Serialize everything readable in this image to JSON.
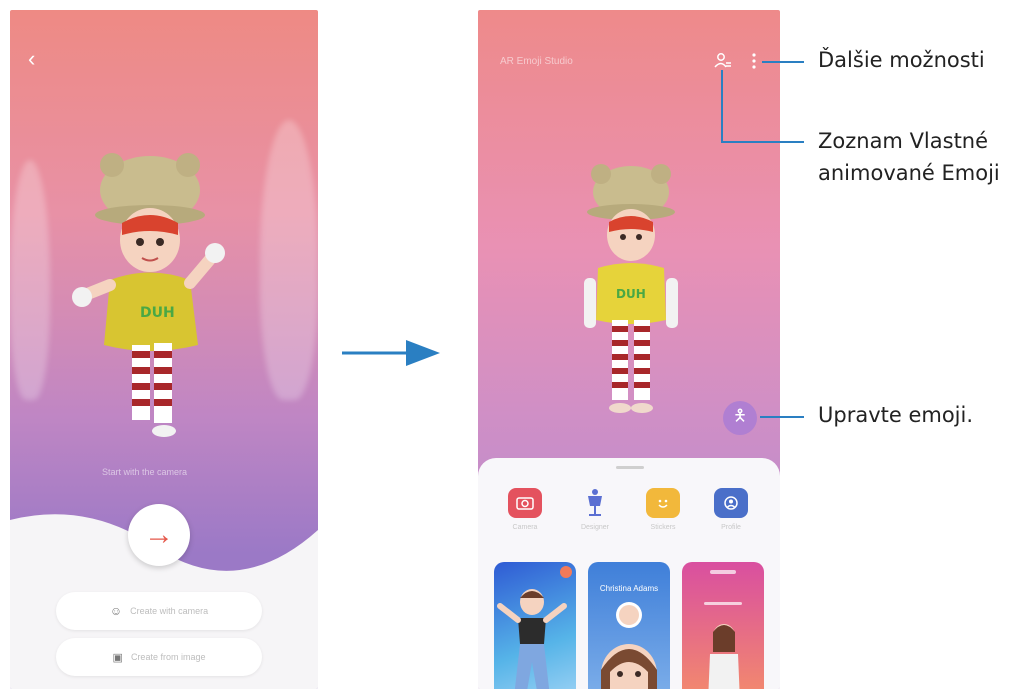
{
  "left_phone": {
    "back_glyph": "‹",
    "next_arrow_glyph": "→",
    "faded_prompt": "Start with the camera",
    "buttons": [
      {
        "label": "Create with camera",
        "icon": "smiley-icon"
      },
      {
        "label": "Create from image",
        "icon": "image-icon"
      }
    ]
  },
  "right_phone": {
    "faded_title": "AR Emoji Studio",
    "tools": [
      {
        "label": "Camera",
        "icon": "camera-icon",
        "color": "#e4525e"
      },
      {
        "label": "Designer",
        "icon": "mannequin-icon",
        "color": "#5b6fd2"
      },
      {
        "label": "Stickers",
        "icon": "sticker-icon",
        "color": "#f2b83b"
      },
      {
        "label": "Profile",
        "icon": "profile-icon",
        "color": "#4a6fc9"
      }
    ],
    "cards": [
      {
        "label": ""
      },
      {
        "label": "Christina Adams"
      },
      {
        "label": ""
      }
    ]
  },
  "callouts": {
    "more_options": "Ďalšie možnosti",
    "list_line1": "Zoznam Vlastné",
    "list_line2": "animované Emoji",
    "edit_emoji": "Upravte emoji."
  },
  "colors": {
    "callout_line": "#2a7fc2",
    "arrow": "#2a7fc2",
    "accent_red": "#e5574a"
  }
}
